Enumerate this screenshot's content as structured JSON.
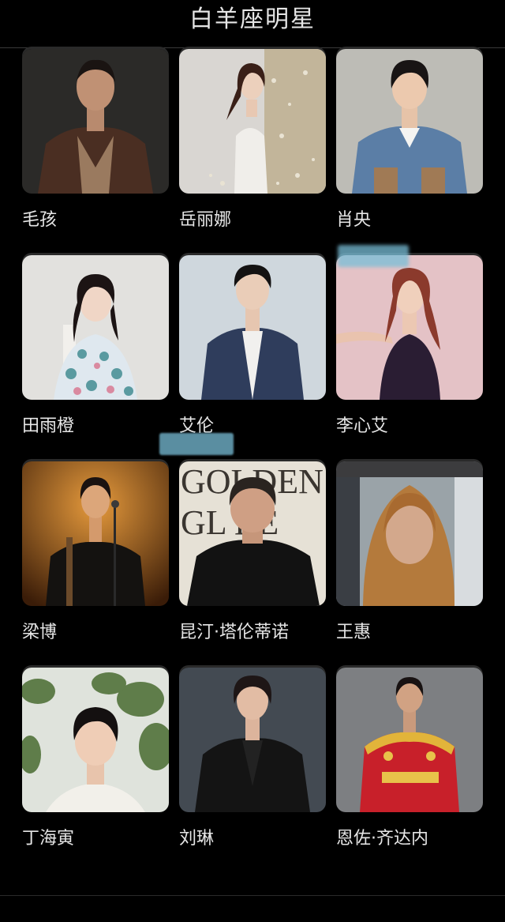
{
  "header": {
    "title": "白羊座明星"
  },
  "stars": [
    {
      "name": "毛孩"
    },
    {
      "name": "岳丽娜"
    },
    {
      "name": "肖央"
    },
    {
      "name": "田雨橙"
    },
    {
      "name": "艾伦"
    },
    {
      "name": "李心艾"
    },
    {
      "name": "梁博"
    },
    {
      "name": "昆汀·塔伦蒂诺"
    },
    {
      "name": "王惠"
    },
    {
      "name": "丁海寅"
    },
    {
      "name": "刘琳"
    },
    {
      "name": "恩佐·齐达内"
    }
  ]
}
